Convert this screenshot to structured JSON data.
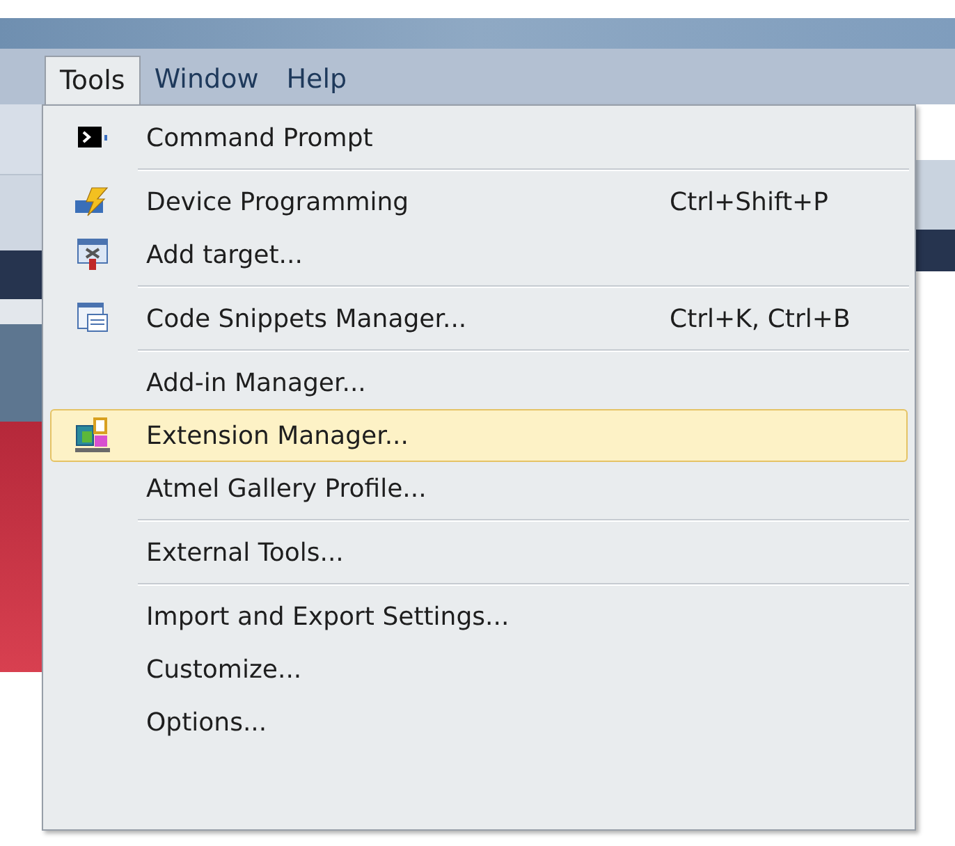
{
  "menu_bar": [
    {
      "label": "Tools",
      "selected": true
    },
    {
      "label": "Window",
      "selected": false
    },
    {
      "label": "Help",
      "selected": false
    }
  ],
  "menu": {
    "items": [
      {
        "label": "Command Prompt",
        "selected": false
      },
      {
        "kind": "separator"
      },
      {
        "label": "Device Programming",
        "shortcut": "Ctrl+Shift+P",
        "selected": false
      },
      {
        "label": "Add target...",
        "selected": false
      },
      {
        "kind": "separator"
      },
      {
        "label": "Code Snippets Manager...",
        "shortcut": "Ctrl+K, Ctrl+B",
        "selected": false
      },
      {
        "kind": "separator"
      },
      {
        "label": "Add-in Manager...",
        "selected": false
      },
      {
        "label": "Extension Manager...",
        "selected": true
      },
      {
        "label": "Atmel Gallery Profile...",
        "selected": false
      },
      {
        "kind": "separator"
      },
      {
        "label": "External Tools...",
        "selected": false
      },
      {
        "kind": "separator"
      },
      {
        "label": "Import and Export Settings...",
        "selected": false
      },
      {
        "label": "Customize...",
        "selected": false
      },
      {
        "label": "Options...",
        "selected": false
      }
    ]
  }
}
